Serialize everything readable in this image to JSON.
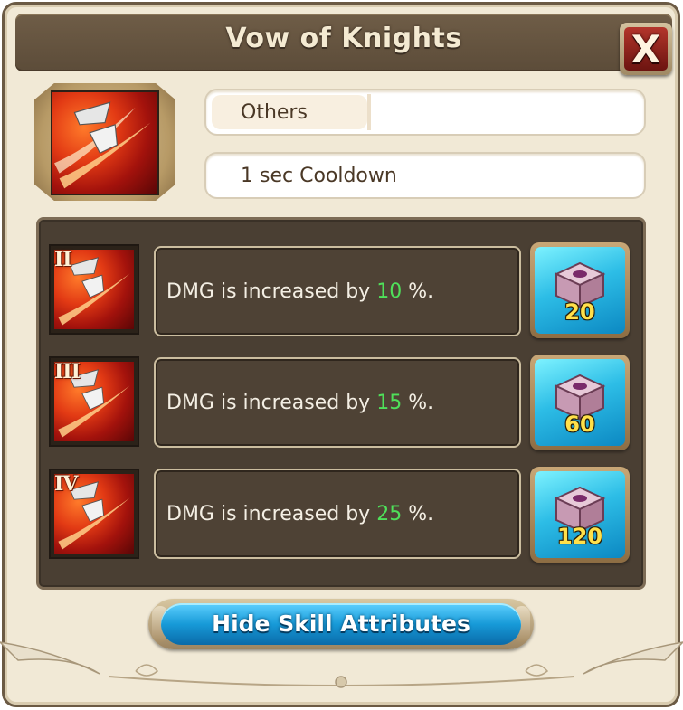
{
  "dialog": {
    "title": "Vow of Knights",
    "close_glyph": "X",
    "close_icon": "close-icon"
  },
  "skill": {
    "icon": "sword-slash-icon",
    "type": "Others",
    "cooldown": "1 sec Cooldown"
  },
  "attributes": [
    {
      "level": "II",
      "prefix": "DMG is increased by ",
      "value": "10",
      "suffix": " %.",
      "cost": "20",
      "cost_icon": "skill-book-icon"
    },
    {
      "level": "III",
      "prefix": "DMG is increased by ",
      "value": "15",
      "suffix": " %.",
      "cost": "60",
      "cost_icon": "skill-book-icon"
    },
    {
      "level": "IV",
      "prefix": "DMG is increased by ",
      "value": "25",
      "suffix": " %.",
      "cost": "120",
      "cost_icon": "skill-book-icon"
    }
  ],
  "footer": {
    "hide_label": "Hide Skill Attributes"
  },
  "colors": {
    "highlight_value": "#4fe05a",
    "cost_text": "#ffe04a",
    "title_bar": "#5c4c39",
    "primary_button": "#179ad8"
  }
}
